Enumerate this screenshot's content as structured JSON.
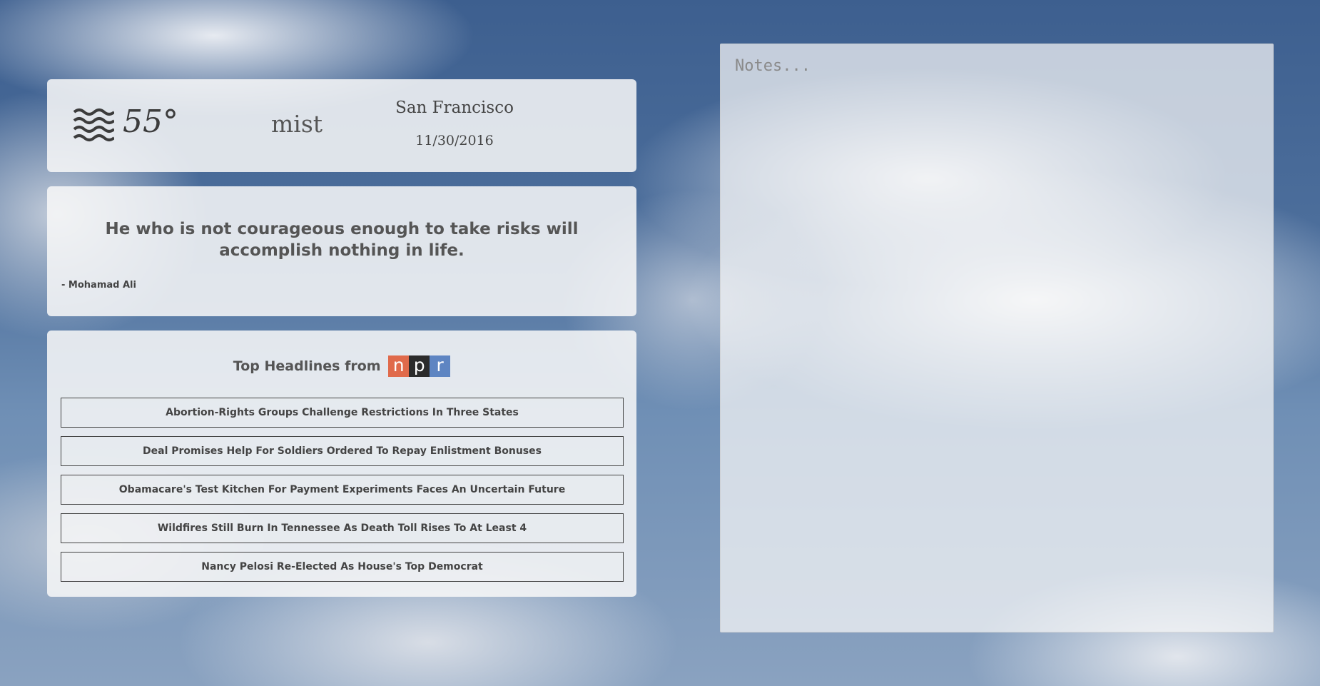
{
  "weather": {
    "icon": "mist-icon",
    "temperature": "55°",
    "description": "mist",
    "city": "San Francisco",
    "date": "11/30/2016"
  },
  "quote": {
    "text": "He who is not courageous enough to take risks will accomplish nothing in life.",
    "author": "- Mohamad Ali"
  },
  "headlines": {
    "title": "Top Headlines from",
    "logo": {
      "letters": [
        "n",
        "p",
        "r"
      ],
      "colors": [
        "#e06a4b",
        "#2b2b2b",
        "#5e85c2"
      ]
    },
    "items": [
      "Abortion-Rights Groups Challenge Restrictions In Three States",
      "Deal Promises Help For Soldiers Ordered To Repay Enlistment Bonuses",
      "Obamacare's Test Kitchen For Payment Experiments Faces An Uncertain Future",
      "Wildfires Still Burn In Tennessee As Death Toll Rises To At Least 4",
      "Nancy Pelosi Re-Elected As House's Top Democrat"
    ]
  },
  "notes": {
    "placeholder": "Notes...",
    "value": ""
  }
}
